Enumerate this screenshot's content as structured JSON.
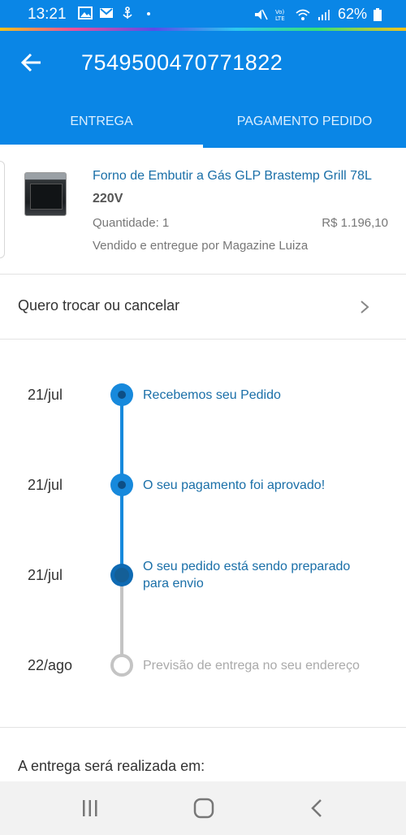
{
  "status_bar": {
    "time": "13:21",
    "battery": "62%",
    "icons": [
      "image-icon",
      "mail-icon",
      "anchor-icon",
      "dot-icon",
      "mute-icon",
      "volte-icon",
      "wifi-icon",
      "signal-icon",
      "battery-icon"
    ]
  },
  "header": {
    "order_number": "7549500470771822",
    "tabs": [
      {
        "label": "ENTREGA",
        "active": true
      },
      {
        "label": "PAGAMENTO PEDIDO",
        "active": false
      }
    ],
    "background_color": "#0a86e6"
  },
  "product": {
    "name": "Forno de Embutir a Gás GLP Brastemp Grill 78L",
    "voltage": "220V",
    "quantity_label": "Quantidade: 1",
    "price": "R$ 1.196,10",
    "seller": "Vendido e entregue por Magazine Luiza"
  },
  "actions": {
    "change_or_cancel": "Quero trocar ou cancelar"
  },
  "timeline": [
    {
      "date": "21/jul",
      "text": "Recebemos seu Pedido",
      "status": "done"
    },
    {
      "date": "21/jul",
      "text": "O seu pagamento foi aprovado!",
      "status": "done"
    },
    {
      "date": "21/jul",
      "text": "O seu pedido está sendo preparado para envio",
      "status": "current"
    },
    {
      "date": "22/ago",
      "text": "Previsão de entrega no seu endereço",
      "status": "pending"
    }
  ],
  "delivery": {
    "label": "A entrega será realizada em:"
  },
  "nav": {
    "buttons": [
      "recent-apps-icon",
      "home-icon",
      "back-icon"
    ]
  }
}
